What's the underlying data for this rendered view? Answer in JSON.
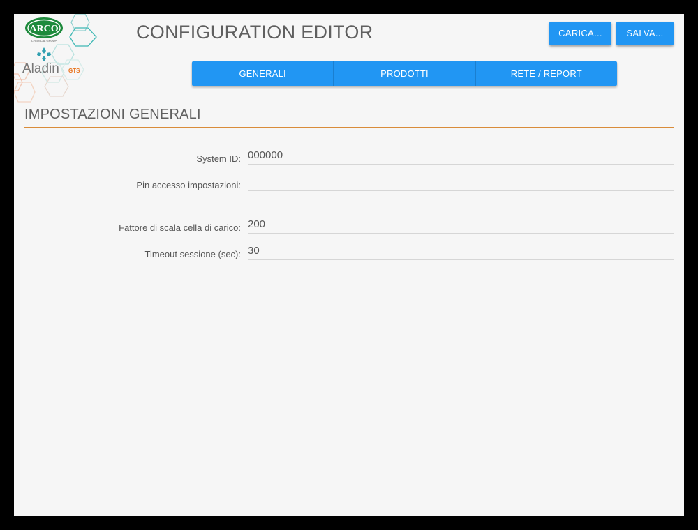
{
  "logo": {
    "brand_top": "ARCO",
    "brand_tagline": "CHEMICAL GROUP",
    "brand_name": "Aladin",
    "brand_suffix": "GTS"
  },
  "header": {
    "title": "CONFIGURATION EDITOR",
    "load_label": "CARICA...",
    "save_label": "SALVA..."
  },
  "tabs": [
    {
      "label": "GENERALI"
    },
    {
      "label": "PRODOTTI"
    },
    {
      "label": "RETE / REPORT"
    }
  ],
  "section": {
    "title": "IMPOSTAZIONI GENERALI"
  },
  "fields": [
    {
      "label": "System ID:",
      "value": "000000"
    },
    {
      "label": "Pin accesso impostazioni:",
      "value": ""
    },
    {
      "label": "Fattore di scala cella di carico:",
      "value": "200"
    },
    {
      "label": "Timeout sessione (sec):",
      "value": "30"
    }
  ],
  "colors": {
    "accent": "#2196f3",
    "section_rule": "#d98c3a",
    "header_rule": "#2f9fd8",
    "arco_green": "#1e8a3c",
    "aladin_orange": "#e8741e"
  }
}
